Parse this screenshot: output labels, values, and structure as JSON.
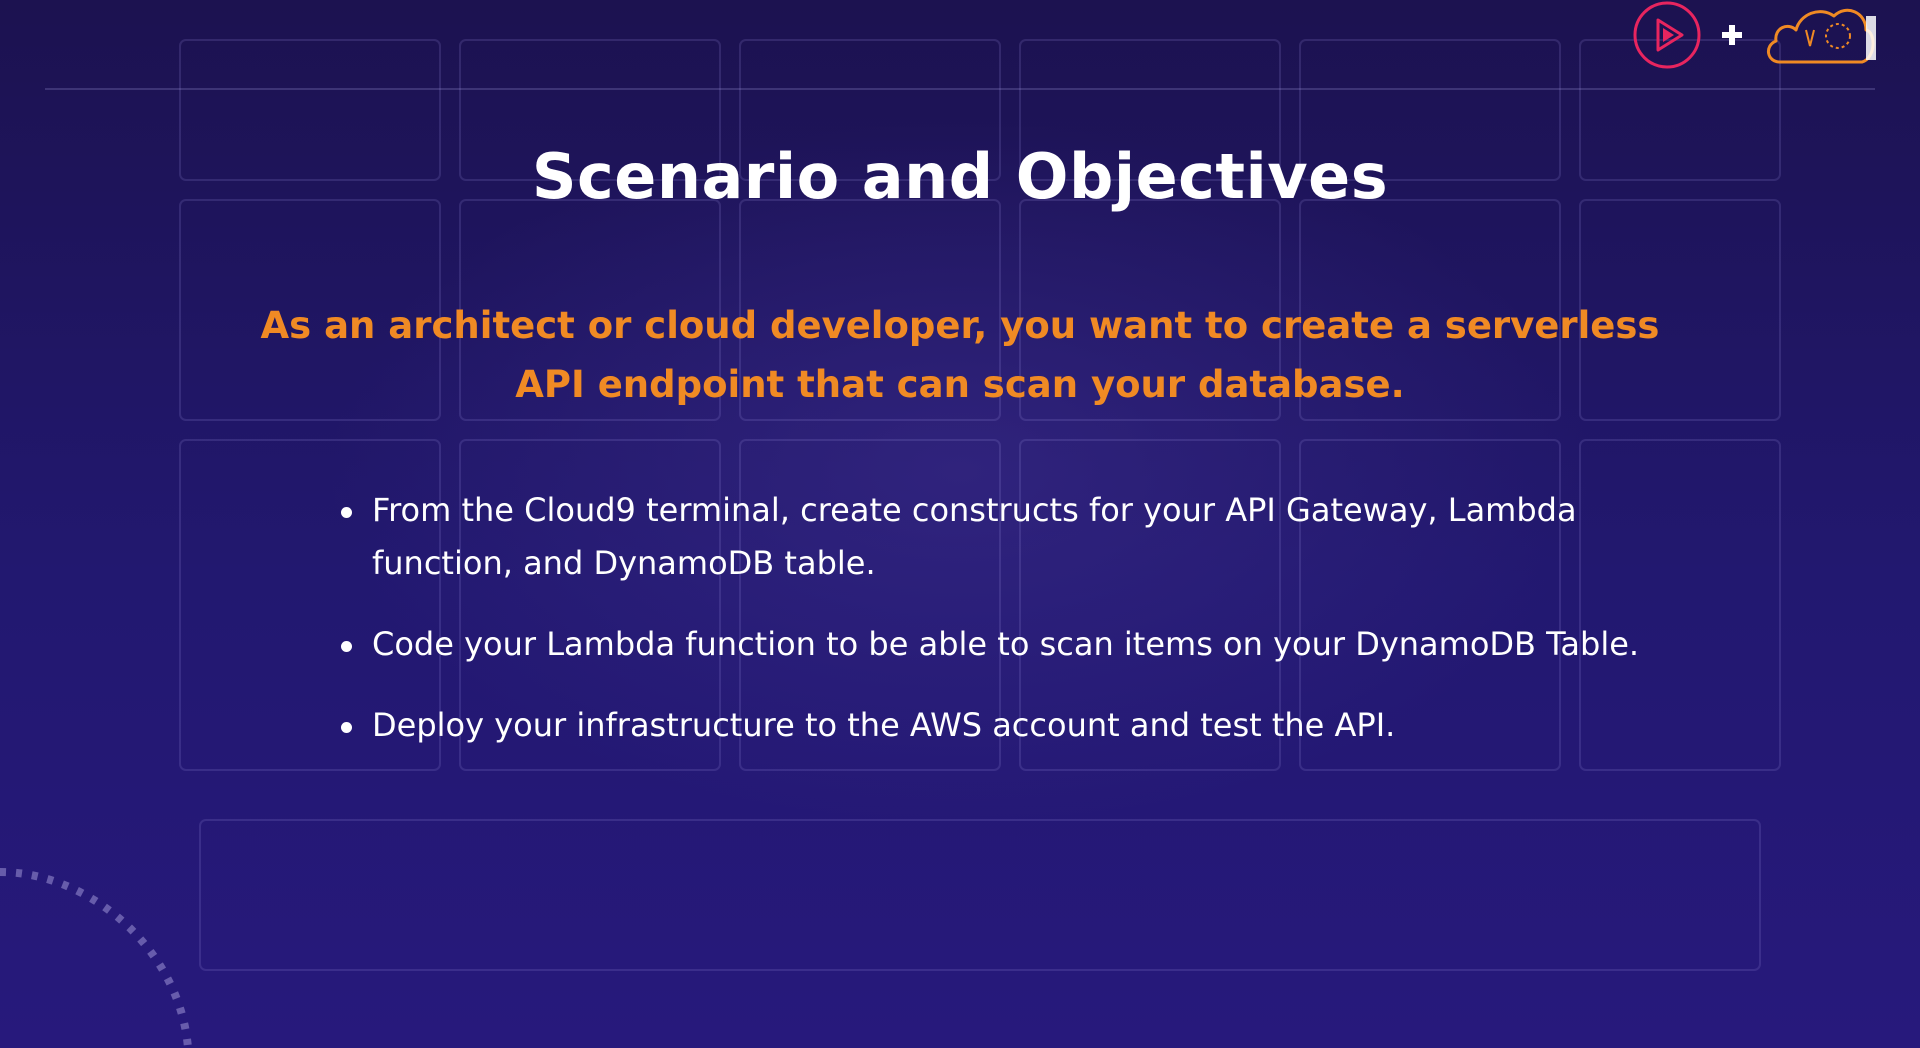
{
  "slide": {
    "title": "Scenario and Objectives",
    "lead": "As an architect or cloud developer, you want to create a serverless API endpoint that can scan your database.",
    "bullets": [
      "From the Cloud9 terminal, create constructs for your API Gateway, Lambda function, and DynamoDB table.",
      "Code your Lambda function to be able to scan items on your DynamoDB Table.",
      "Deploy your infrastructure to the AWS account and test the API."
    ]
  },
  "brand": {
    "icons": [
      "play-logo-icon",
      "plus-icon",
      "cloud-logo-icon"
    ]
  },
  "colors": {
    "background": "#1a1152",
    "title": "#ffffff",
    "accent": "#f08a24",
    "play_logo": "#e8255f",
    "cloud_logo": "#f08a24"
  }
}
